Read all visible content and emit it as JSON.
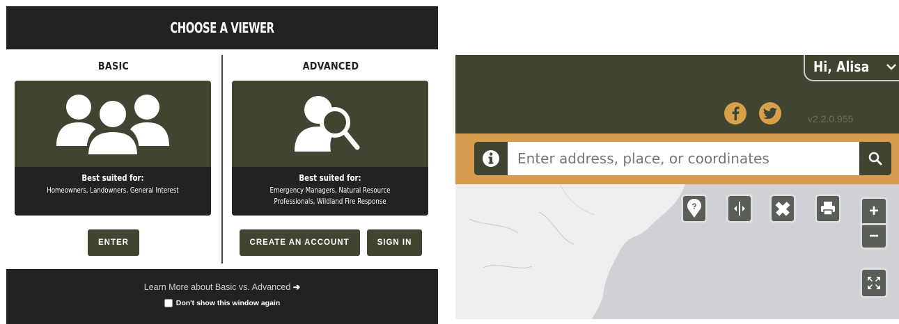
{
  "chooser": {
    "title": "CHOOSE A VIEWER",
    "basic": {
      "heading": "BASIC",
      "icon": "group-of-people-icon",
      "suited_label": "Best suited for:",
      "suited_for": "Homeowners, Landowners, General Interest",
      "enter_label": "ENTER"
    },
    "advanced": {
      "heading": "ADVANCED",
      "icon": "person-search-icon",
      "suited_label": "Best suited for:",
      "suited_for": "Emergency Managers, Natural Resource Professionals, Wildland Fire Response",
      "create_account_label": "CREATE AN ACCOUNT",
      "sign_in_label": "SIGN IN"
    },
    "footer": {
      "learn_more": "Learn More about Basic vs. Advanced",
      "learn_more_arrow": "➔",
      "dont_show": "Don't show this window again",
      "dont_show_checked": false
    }
  },
  "map_ui": {
    "user_greeting": "Hi, Alisa",
    "social": [
      "facebook-icon",
      "twitter-icon"
    ],
    "version": "v2.2.0.955",
    "search": {
      "placeholder": "Enter address, place, or coordinates",
      "info_icon": "info-icon",
      "search_icon": "search-icon"
    },
    "tools": [
      "identify-pin-icon",
      "swipe-compare-icon",
      "measure-ruler-icon",
      "print-icon"
    ],
    "zoom": {
      "in_label": "+",
      "out_label": "−"
    },
    "fullscreen_icon": "fullscreen-icon"
  },
  "colors": {
    "olive": "#3f4530",
    "dark": "#222222",
    "accent_orange": "#d89c4e",
    "map_gray": "#cfd1d6"
  }
}
